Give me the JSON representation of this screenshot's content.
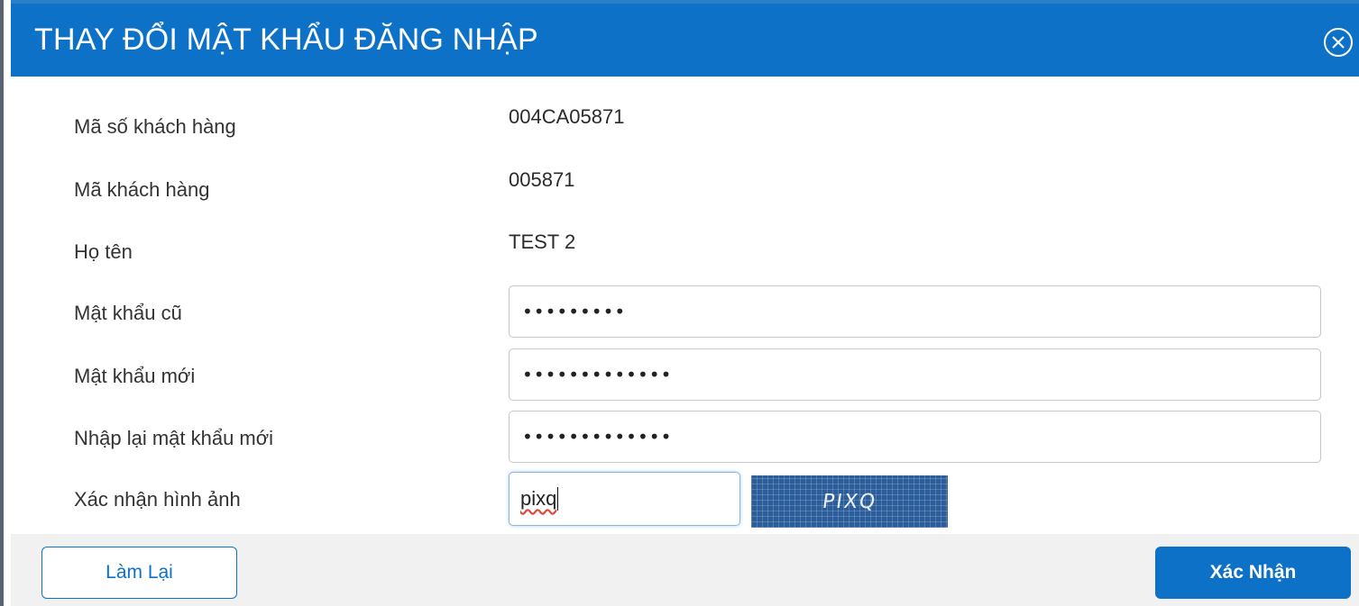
{
  "dialog": {
    "title": "THAY ĐỔI MẬT KHẨU ĐĂNG NHẬP",
    "close_icon": "close-circle-icon"
  },
  "fields": {
    "customer_number": {
      "label": "Mã số khách hàng",
      "value": "004CA05871"
    },
    "customer_code": {
      "label": "Mã khách hàng",
      "value": "005871"
    },
    "full_name": {
      "label": "Họ tên",
      "value": "TEST 2"
    },
    "old_password": {
      "label": "Mật khẩu cũ",
      "value": "•••••••••"
    },
    "new_password": {
      "label": "Mật khẩu mới",
      "value": "•••••••••••••"
    },
    "confirm_password": {
      "label": "Nhập lại mật khẩu mới",
      "value": "•••••••••••••"
    },
    "captcha": {
      "label": "Xác nhận hình ảnh",
      "value": "pixq",
      "image_text": "PIXQ"
    }
  },
  "buttons": {
    "reset_label": "Làm Lại",
    "confirm_label": "Xác Nhận"
  },
  "colors": {
    "primary": "#0d72c7",
    "footer_bg": "#f1f1f1"
  }
}
